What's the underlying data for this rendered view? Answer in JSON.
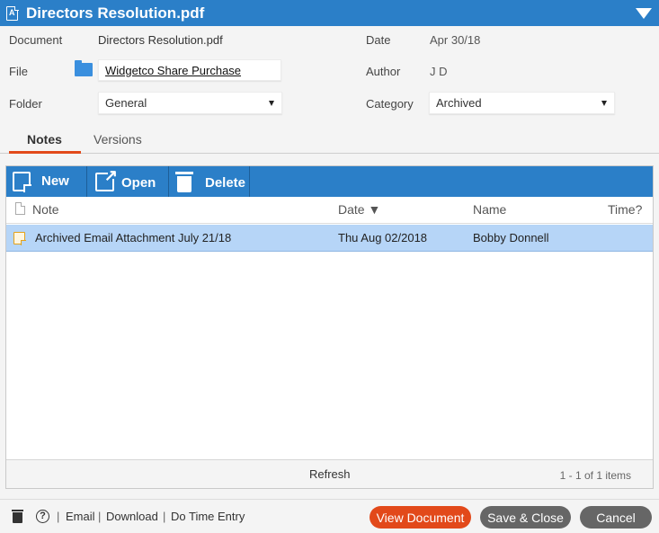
{
  "window": {
    "title": "Directors Resolution.pdf"
  },
  "fields": {
    "document_label": "Document",
    "document_value": "Directors Resolution.pdf",
    "file_label": "File",
    "file_value": "Widgetco Share Purchase",
    "folder_label": "Folder",
    "folder_value": "General",
    "date_label": "Date",
    "date_value": "Apr 30/18",
    "author_label": "Author",
    "author_value": "J D",
    "category_label": "Category",
    "category_value": "Archived"
  },
  "tabs": [
    {
      "label": "Notes",
      "active": true
    },
    {
      "label": "Versions",
      "active": false
    }
  ],
  "toolbar": {
    "new_label": "New",
    "open_label": "Open",
    "delete_label": "Delete"
  },
  "grid": {
    "columns": {
      "note": "Note",
      "date": "Date ▼",
      "name": "Name",
      "time": "Time?"
    },
    "rows": [
      {
        "note": "Archived Email Attachment July 21/18",
        "date": "Thu Aug 02/2018",
        "name": "Bobby Donnell",
        "time": ""
      }
    ],
    "refresh_label": "Refresh",
    "count_text": "1 - 1 of 1 items"
  },
  "footer": {
    "help_glyph": "?",
    "links": [
      "Email",
      "Download",
      "Do Time Entry"
    ],
    "separator": "|",
    "view_document": "View Document",
    "save_close": "Save & Close",
    "cancel": "Cancel"
  },
  "colors": {
    "accent": "#2b7fc8",
    "primary_button": "#e2491a",
    "secondary_button": "#666666",
    "selected_row": "#b6d5f7"
  }
}
